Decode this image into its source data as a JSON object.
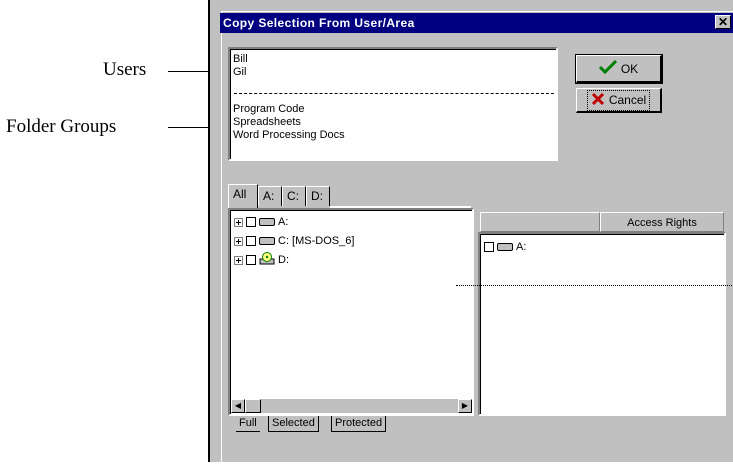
{
  "callouts": {
    "users": "Users",
    "folder_groups": "Folder Groups"
  },
  "dialog": {
    "title": "Copy Selection From User/Area",
    "close_glyph": "✕"
  },
  "source_list": {
    "users": [
      "Bill",
      "Gil"
    ],
    "folder_groups": [
      "Program Code",
      "Spreadsheets",
      "Word Processing Docs"
    ]
  },
  "buttons": {
    "ok_label": "OK",
    "cancel_label": "Cancel"
  },
  "drive_tabs": [
    "All",
    "A:",
    "C:",
    "D:"
  ],
  "tree": {
    "items": [
      {
        "label": "A:",
        "icon": "floppy-drive-icon"
      },
      {
        "label": "C: [MS-DOS_6]",
        "icon": "hard-drive-icon"
      },
      {
        "label": "D:",
        "icon": "cd-drive-icon"
      }
    ]
  },
  "right_panel": {
    "header": "Access Rights",
    "items": [
      {
        "label": "A:",
        "icon": "floppy-drive-icon"
      }
    ]
  },
  "bottom_tabs": [
    "Full",
    "Selected",
    "Protected"
  ],
  "colors": {
    "titlebar": "#000080",
    "face": "#c0c0c0",
    "ok_check": "#008000",
    "cancel_x": "#c00000"
  }
}
